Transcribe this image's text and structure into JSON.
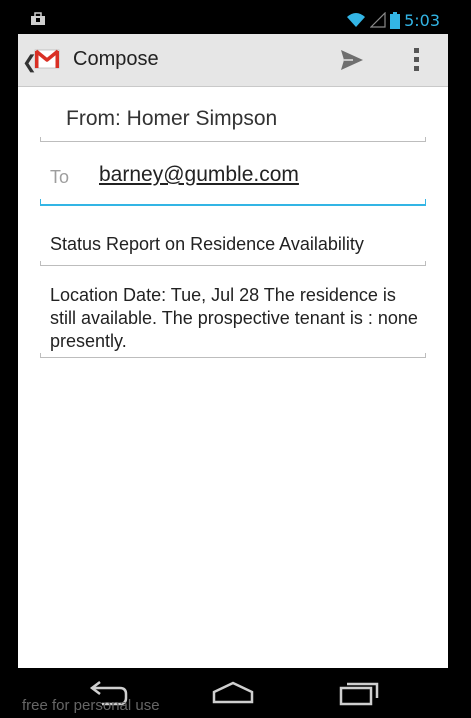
{
  "status_bar": {
    "time": "5:03",
    "icons": [
      "notification-bag-icon",
      "wifi-icon",
      "signal-icon",
      "battery-icon"
    ]
  },
  "action_bar": {
    "title": "Compose",
    "icons": [
      "back-caret-icon",
      "gmail-icon",
      "send-icon",
      "overflow-menu-icon"
    ]
  },
  "compose": {
    "from": "From: Homer Simpson",
    "to_label": "To",
    "to_recipient": "barney@gumble.com",
    "subject": "Status Report on Residence Availability",
    "body": "Location  Date: Tue, Jul 28 The residence is still available. The prospective tenant is : none presently."
  },
  "nav_bar": {
    "icons": [
      "back-icon",
      "home-icon",
      "recent-apps-icon"
    ]
  },
  "watermark": "free for personal use",
  "colors": {
    "accent": "#33b5e5",
    "action_bar_bg": "#e6e6e6",
    "gmail_red": "#d93025"
  }
}
